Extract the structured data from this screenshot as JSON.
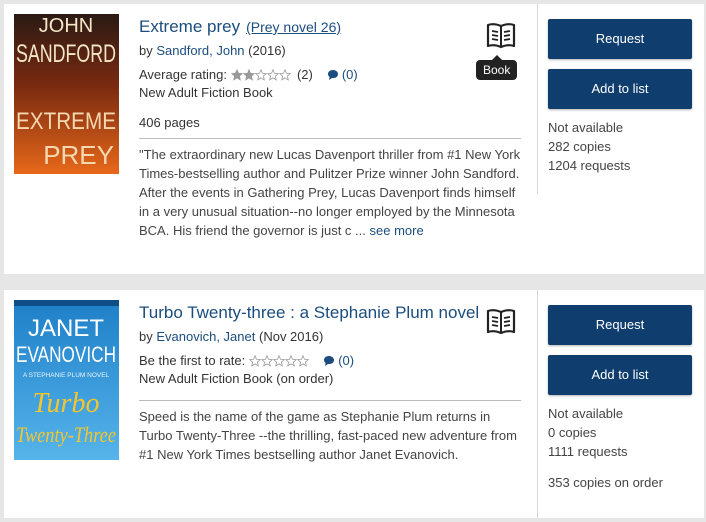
{
  "results": [
    {
      "title": "Extreme prey",
      "series": "(Prey novel 26)",
      "by_prefix": "by",
      "author": "Sandford, John",
      "date": "(2016)",
      "rating_label": "Average rating:",
      "rating_stars": 2,
      "rating_count": "(2)",
      "comment_count": "(0)",
      "format": "New Adult Fiction Book",
      "pages": "406 pages",
      "description": "\"The extraordinary new Lucas Davenport thriller from #1 New York Times-bestselling author and Pulitzer Prize winner John Sandford. After the events in Gathering Prey, Lucas Davenport finds himself in a very unusual situation--no longer employed by the Minnesota BCA. His friend the governor is just c ...",
      "see_more": "see more",
      "format_icon": "book-icon",
      "tooltip": "Book",
      "request_label": "Request",
      "add_label": "Add to list",
      "availability": "Not available",
      "copies": "282 copies",
      "requests": "1204 requests",
      "cover": {
        "author_line1": "JOHN",
        "author_line2": "SANDFORD",
        "title_line1": "EXTREME",
        "title_line2": "PREY"
      }
    },
    {
      "title": "Turbo Twenty-three : a Stephanie Plum novel",
      "by_prefix": "by",
      "author": "Evanovich, Janet",
      "date": "(Nov 2016)",
      "rating_label": "Be the first to rate:",
      "rating_stars": 0,
      "comment_count": "(0)",
      "format": "New Adult Fiction Book (on order)",
      "description": "Speed is the name of the game as Stephanie Plum returns in Turbo Twenty-Three --the thrilling, fast-paced new adventure from #1 New York Times bestselling author Janet Evanovich.",
      "format_icon": "book-icon",
      "request_label": "Request",
      "add_label": "Add to list",
      "availability": "Not available",
      "copies": "0 copies",
      "requests": "1111 requests",
      "on_order": "353 copies on order",
      "cover": {
        "author_line1": "JANET",
        "author_line2": "EVANOVICH",
        "tagline": "A STEPHANIE PLUM NOVEL",
        "title_line1": "Turbo",
        "title_line2": "Twenty-Three"
      }
    }
  ],
  "colors": {
    "link": "#1b4d7e",
    "button": "#0e3d6e",
    "background": "#e6e6e6"
  }
}
